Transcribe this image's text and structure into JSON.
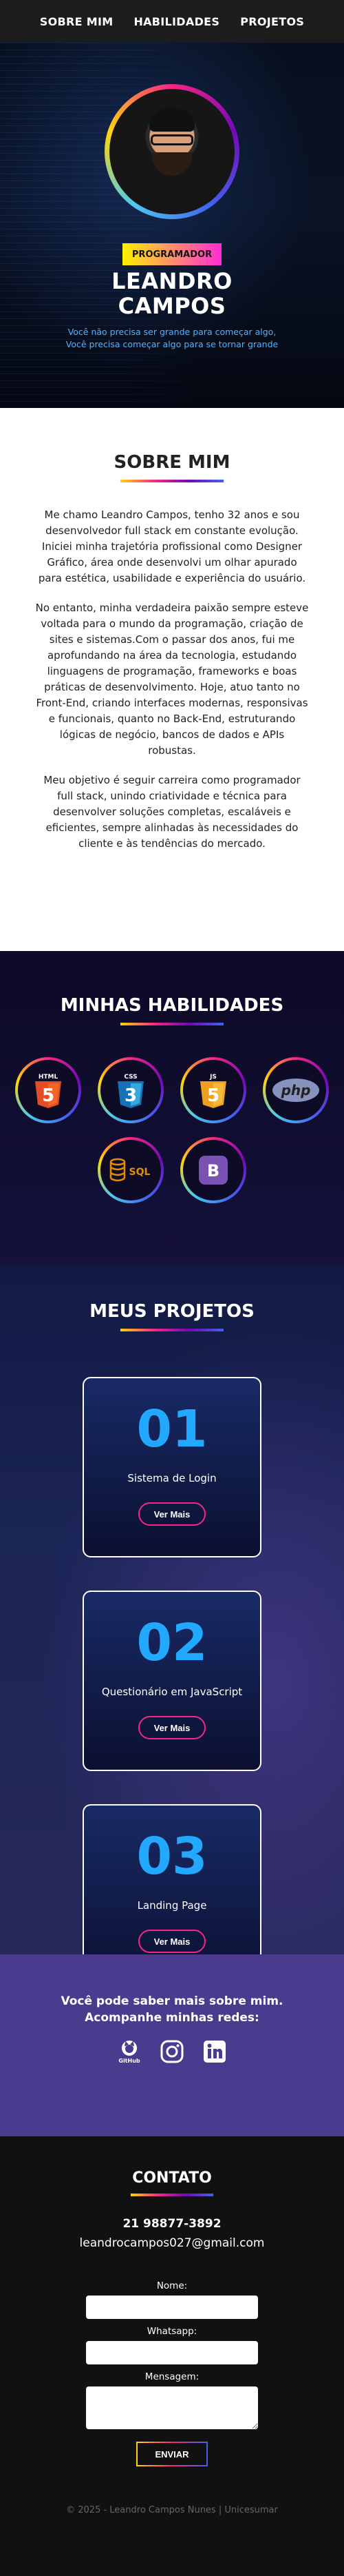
{
  "nav": {
    "items": [
      "SOBRE MIM",
      "HABILIDADES",
      "PROJETOS"
    ]
  },
  "hero": {
    "role": "PROGRAMADOR",
    "name_line1": "LEANDRO",
    "name_line2": "CAMPOS",
    "tagline1": "Você não precisa ser grande para começar algo,",
    "tagline2": "Você precisa começar algo para se tornar grande"
  },
  "about": {
    "title": "SOBRE MIM",
    "p1": "Me chamo Leandro Campos, tenho 32 anos e sou desenvolvedor full stack em constante evolução. Iniciei minha trajetória profissional como Designer Gráfico, área onde desenvolvi um olhar apurado para estética, usabilidade e experiência do usuário.",
    "p2": "No entanto, minha verdadeira paixão sempre esteve voltada para o mundo da programação, criação de sites e sistemas.Com o passar dos anos, fui me aprofundando na área da tecnologia, estudando linguagens de programação, frameworks e boas práticas de desenvolvimento. Hoje, atuo tanto no Front-End, criando interfaces modernas, responsivas e funcionais, quanto no Back-End, estruturando lógicas de negócio, bancos de dados e APIs robustas.",
    "p3": "Meu objetivo é seguir carreira como programador full stack, unindo criatividade e técnica para desenvolver soluções completas, escaláveis e eficientes, sempre alinhadas às necessidades do cliente e às tendências do mercado."
  },
  "skills": {
    "title": "MINHAS HABILIDADES",
    "items": [
      {
        "label": "HTML",
        "glyph": "5",
        "color": "#e44d26"
      },
      {
        "label": "CSS",
        "glyph": "3",
        "color": "#2965f1"
      },
      {
        "label": "JS",
        "glyph": "5",
        "color": "#f7a21b"
      },
      {
        "label": "php",
        "color": "#8892bf"
      },
      {
        "label": "SQL",
        "color": "#e38c00"
      },
      {
        "label": "B",
        "color": "#7952b3"
      }
    ]
  },
  "projects": {
    "title": "MEUS PROJETOS",
    "items": [
      {
        "num": "01",
        "name": "Sistema de Login",
        "button": "Ver Mais"
      },
      {
        "num": "02",
        "name": "Questionário em JavaScript",
        "button": "Ver Mais"
      },
      {
        "num": "03",
        "name": "Landing Page",
        "button": "Ver Mais"
      }
    ]
  },
  "social": {
    "text": "Você pode saber mais sobre mim. Acompanhe minhas redes:",
    "icons": [
      "github-icon",
      "instagram-icon",
      "linkedin-icon"
    ],
    "github_label": "GitHub"
  },
  "contact": {
    "title": "CONTATO",
    "phone": "21 98877-3892",
    "email": "leandrocampos027@gmail.com",
    "name_label": "Nome:",
    "whatsapp_label": "Whatsapp:",
    "message_label": "Mensagem:",
    "send": "ENVIAR",
    "footer": "© 2025 - Leandro Campos Nunes | Unicesumar"
  }
}
